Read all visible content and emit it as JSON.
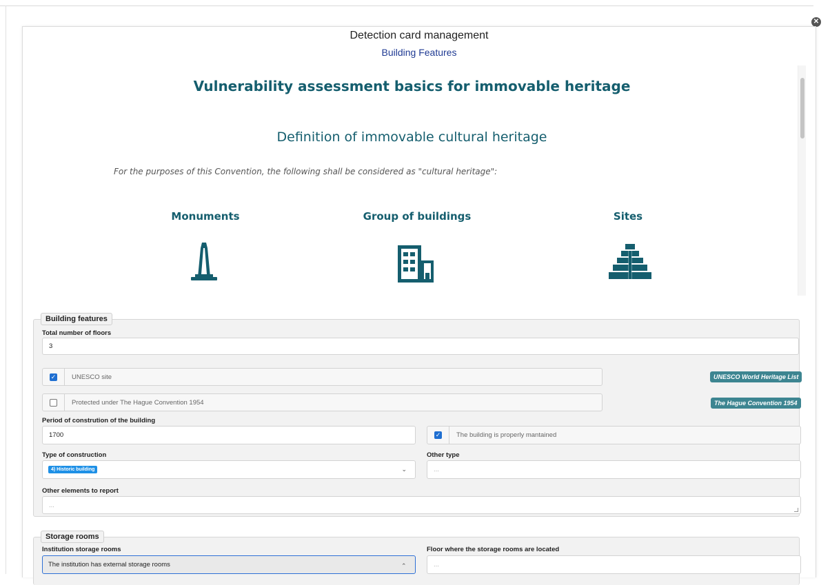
{
  "modal": {
    "title": "Detection card management",
    "subtitle": "Building Features",
    "close_icon": "close-circle-icon"
  },
  "info": {
    "heading": "Vulnerability assessment basics for immovable heritage",
    "definition_heading": "Definition of immovable cultural heritage",
    "intro": "For the purposes of this Convention, the following shall be considered as \"cultural heritage\":",
    "categories": [
      {
        "label": "Monuments",
        "icon": "monument-obelisk-icon"
      },
      {
        "label": "Group of buildings",
        "icon": "buildings-group-icon"
      },
      {
        "label": "Sites",
        "icon": "stepped-pyramid-site-icon"
      }
    ],
    "accent_color": "#155e6e"
  },
  "building_features": {
    "legend": "Building features",
    "floors_label": "Total number of floors",
    "floors_value": "3",
    "unesco": {
      "checked": true,
      "label": "UNESCO site",
      "link": "UNESCO World Heritage List"
    },
    "hague": {
      "checked": false,
      "label": "Protected under The Hague Convention 1954",
      "link": "The Hague Convention 1954"
    },
    "period_label": "Period of constrution of the building",
    "period_value": "1700",
    "maintained": {
      "checked": true,
      "label": "The building is properly mantained"
    },
    "construction_type_label": "Type of construction",
    "construction_type_value": "4) Historic building",
    "other_type_label": "Other type",
    "other_type_placeholder": "...",
    "other_elements_label": "Other elements to report",
    "other_elements_placeholder": "..."
  },
  "storage_rooms": {
    "legend": "Storage rooms",
    "institution_label": "Institution storage rooms",
    "institution_value": "The institution has external storage rooms",
    "floor_label": "Floor where the storage rooms are located",
    "floor_placeholder": "..."
  }
}
